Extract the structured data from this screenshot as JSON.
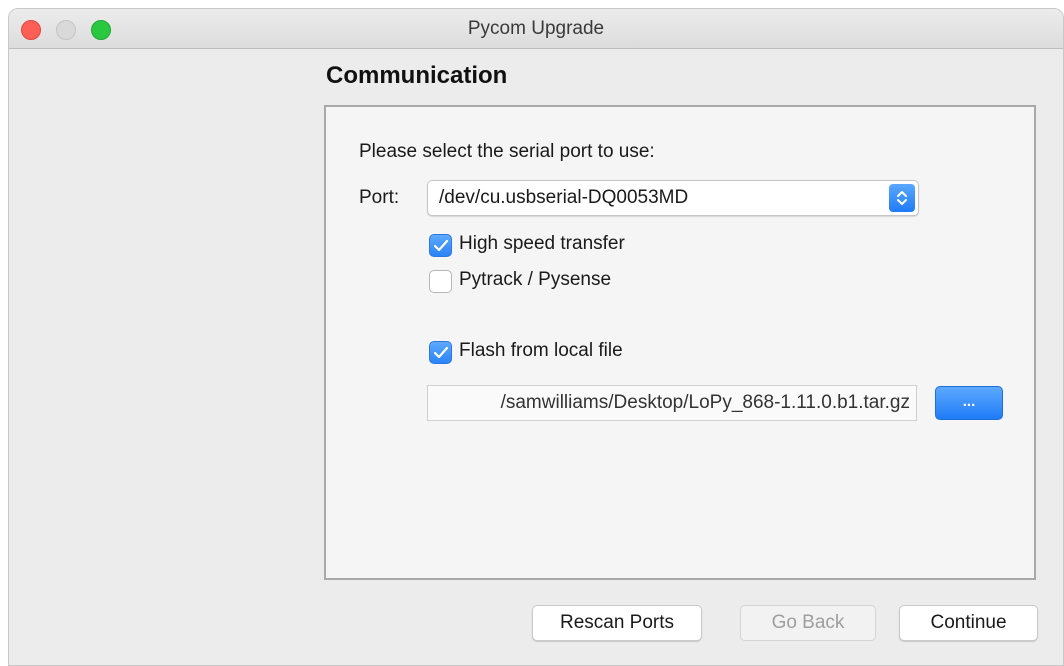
{
  "window": {
    "title": "Pycom Upgrade"
  },
  "page": {
    "heading": "Communication",
    "prompt": "Please select the serial port to use:",
    "port_label": "Port:",
    "port_value": "/dev/cu.usbserial-DQ0053MD",
    "options": [
      {
        "label": "High speed transfer",
        "checked": true
      },
      {
        "label": "Pytrack / Pysense",
        "checked": false
      },
      {
        "label": "Flash from local file",
        "checked": true
      }
    ],
    "file_path": "/samwilliams/Desktop/LoPy_868-1.11.0.b1.tar.gz",
    "browse_label": "..."
  },
  "footer": {
    "rescan_label": "Rescan Ports",
    "back_label": "Go Back",
    "continue_label": "Continue"
  },
  "colors": {
    "accent": "#2a83f7",
    "close": "#fd5f57",
    "maximize": "#2ac841"
  }
}
